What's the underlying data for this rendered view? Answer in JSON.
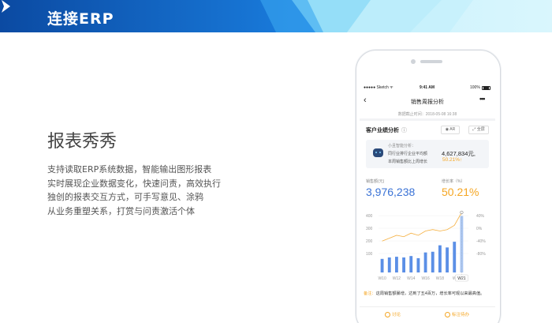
{
  "banner": {
    "title": "连接ERP",
    "colors": {
      "dark": "#0a4fa8",
      "mid": "#1e88e5",
      "light": "#7ed6f5"
    }
  },
  "intro": {
    "title": "报表秀秀",
    "lines": [
      "支持读取ERP系统数据，智能输出图形报表",
      "实时展现企业数据变化，快速问责，高效执行",
      "独创的报表交互方式，可手写意见、涂鸦",
      "从业务重塑关系，打赏与问责激活个体"
    ]
  },
  "phone": {
    "status": {
      "carrier": "●●●●● Sketch ᯤ",
      "time": "9:41 AM",
      "battery": "100%"
    },
    "nav": {
      "back": "‹",
      "title": "销售周报分析",
      "more": "•••"
    },
    "data_time": "数据截止时间：2018-05-08 16:38",
    "section": {
      "title": "客户业绩分析",
      "info": "ⓘ",
      "btn_ar": "AR",
      "btn_full": "全屏"
    },
    "ai": {
      "label": "小且智能分析：",
      "line1": "同行业排行企业平均额",
      "value1": "4,627,834元,",
      "line2": "本周销售额比上周增长",
      "value2": "50.21%↑"
    },
    "kpi": {
      "sales_label": "销售额(元)",
      "sales_value": "3,976,238",
      "growth_label": "增长率（%）",
      "growth_value": "50.21%"
    },
    "note": {
      "prefix": "备注：",
      "text": "这周销售额暴增，达到了五4百万，增长率可观以来最高值。"
    },
    "footer": {
      "comment": "讨论",
      "follow": "标注待办"
    }
  },
  "chart_data": {
    "type": "bar",
    "categories": [
      "W10",
      "",
      "W12",
      "",
      "W14",
      "",
      "W16",
      "",
      "W18",
      "",
      "W",
      "W21"
    ],
    "values": [
      95,
      105,
      110,
      105,
      115,
      100,
      140,
      145,
      190,
      175,
      215,
      395
    ],
    "line_values": [
      220,
      240,
      260,
      250,
      275,
      260,
      290,
      300,
      290,
      300,
      330,
      420
    ],
    "yticks_left": [
      "400",
      "300",
      "200",
      "100"
    ],
    "yticks_right": [
      "40%",
      "0%",
      "-40%",
      "-80%"
    ],
    "ylim": [
      0,
      420
    ],
    "highlight_label": "W21",
    "colors": {
      "bar": "#5b8fe6",
      "bar_highlight": "#a9c6f3",
      "line": "#f5b041"
    }
  }
}
